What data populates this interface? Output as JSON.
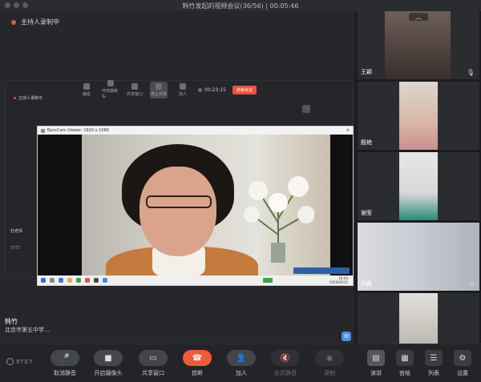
{
  "window": {
    "title": "韩竹发起的视频会议(36/56) | 00:05:46"
  },
  "main": {
    "recording_label": "主持人录制中",
    "speaker_name": "韩竹",
    "speaker_org": "北京市第五中学..."
  },
  "shared_screen": {
    "inner_recording_label": "主持人录制中",
    "inner_toolbar": {
      "buttons": [
        "静音",
        "开启摄像头",
        "共享窗口",
        "停止共享",
        "加人"
      ],
      "timer": "00:23:15",
      "end_label": "结束会议"
    },
    "inner_name": "杜老师",
    "inner_brand": "9TET",
    "app_window_title": "EpocCam Viewer: 1920 x 1080",
    "clock_time": "16:04",
    "clock_date": "2020/02/22"
  },
  "participants": [
    {
      "name": "王颖",
      "muted": true
    },
    {
      "name": "殷艳",
      "muted": false
    },
    {
      "name": "谢莹",
      "muted": false
    },
    {
      "name": "刘鑫",
      "muted": false
    },
    {
      "name": "",
      "muted": false
    }
  ],
  "toolbar": {
    "brand": "9TET",
    "items": [
      {
        "label": "取消静音",
        "icon": "mic-icon"
      },
      {
        "label": "开启摄像头",
        "icon": "camera-icon"
      },
      {
        "label": "共享窗口",
        "icon": "share-screen-icon"
      },
      {
        "label": "挂断",
        "icon": "hangup-icon"
      },
      {
        "label": "加人",
        "icon": "add-person-icon"
      },
      {
        "label": "全员静音",
        "icon": "mute-all-icon"
      },
      {
        "label": "录制",
        "icon": "record-icon"
      }
    ],
    "view_items": [
      {
        "label": "演讲",
        "icon": "speaker-view-icon"
      },
      {
        "label": "宫格",
        "icon": "grid-view-icon"
      },
      {
        "label": "列表",
        "icon": "list-view-icon"
      },
      {
        "label": "设置",
        "icon": "settings-icon"
      }
    ]
  },
  "colors": {
    "accent_end": "#ef5b37",
    "record_dot": "#e8553f",
    "background": "#1f2023"
  }
}
